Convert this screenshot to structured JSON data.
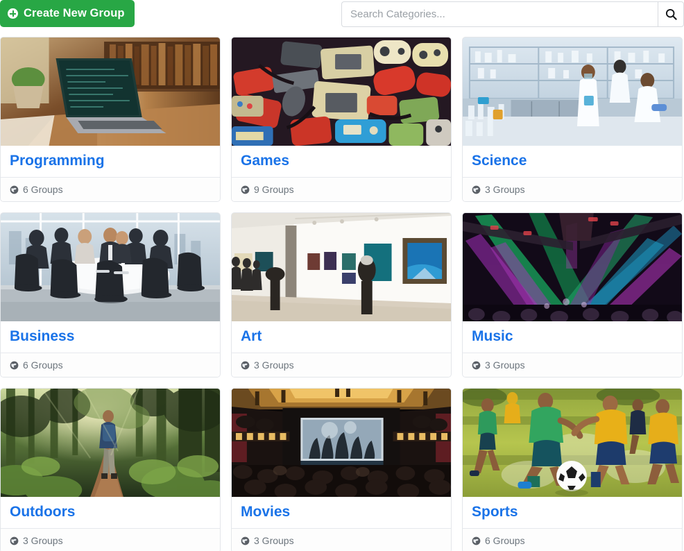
{
  "toolbar": {
    "create_label": "Create New Group",
    "create_icon": "plus-circle-icon",
    "create_color": "#28a745"
  },
  "search": {
    "placeholder": "Search Categories...",
    "value": "",
    "button_icon": "search-icon"
  },
  "theme": {
    "title_link_color": "#1a73e8",
    "meta_text_color": "#6c757d",
    "card_border_color": "#e3e6ea"
  },
  "categories": [
    {
      "title": "Programming",
      "groups_label": "6 Groups",
      "count": 6,
      "image": "laptop-desk",
      "icon": "globe-icon"
    },
    {
      "title": "Games",
      "groups_label": "9 Groups",
      "count": 9,
      "image": "retro-controllers",
      "icon": "globe-icon"
    },
    {
      "title": "Science",
      "groups_label": "3 Groups",
      "count": 3,
      "image": "laboratory",
      "icon": "globe-icon"
    },
    {
      "title": "Business",
      "groups_label": "6 Groups",
      "count": 6,
      "image": "boardroom",
      "icon": "globe-icon"
    },
    {
      "title": "Art",
      "groups_label": "3 Groups",
      "count": 3,
      "image": "art-gallery",
      "icon": "globe-icon"
    },
    {
      "title": "Music",
      "groups_label": "3 Groups",
      "count": 3,
      "image": "concert-lights",
      "icon": "globe-icon"
    },
    {
      "title": "Outdoors",
      "groups_label": "3 Groups",
      "count": 3,
      "image": "forest-hiker",
      "icon": "globe-icon"
    },
    {
      "title": "Movies",
      "groups_label": "3 Groups",
      "count": 3,
      "image": "cinema-hall",
      "icon": "globe-icon"
    },
    {
      "title": "Sports",
      "groups_label": "6 Groups",
      "count": 6,
      "image": "soccer-match",
      "icon": "globe-icon"
    }
  ]
}
